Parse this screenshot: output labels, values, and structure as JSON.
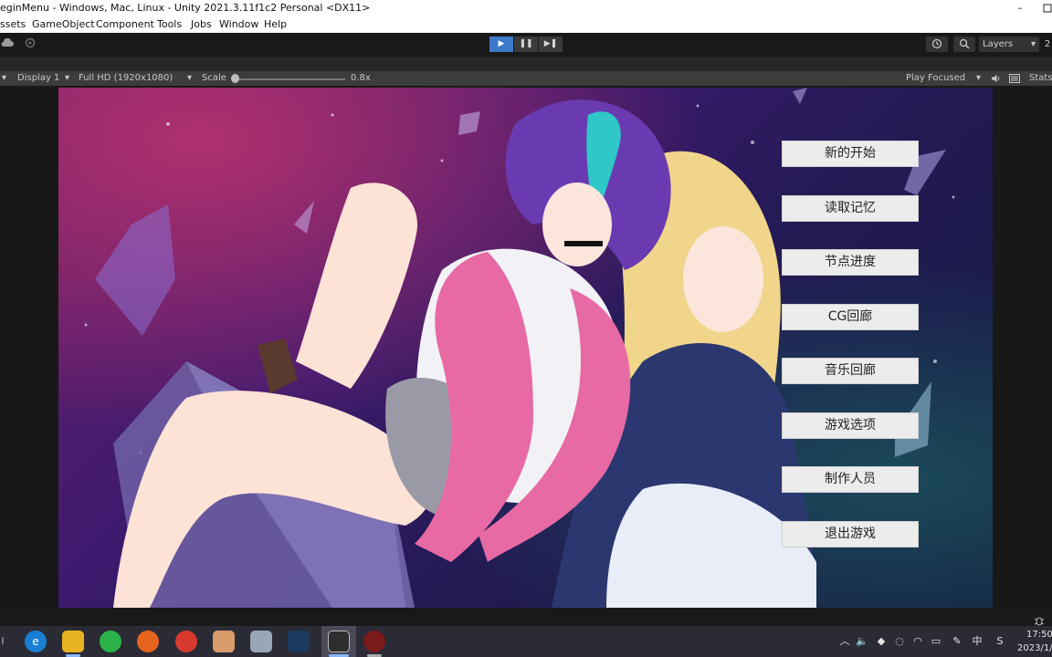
{
  "window": {
    "title": "eginMenu - Windows, Mac, Linux - Unity 2021.3.11f1c2 Personal <DX11>",
    "minimize": "–"
  },
  "menu": [
    "ssets",
    "GameObject",
    "Component",
    "Tools",
    "Jobs",
    "Window",
    "Help"
  ],
  "toolbar": {
    "play": "▶",
    "pause": "❚❚",
    "step": "▶❚",
    "layers_label": "Layers",
    "edge_label": "2"
  },
  "game_view": {
    "display": "Display 1",
    "resolution": "Full HD (1920x1080)",
    "scale_label": "Scale",
    "scale_value": "0.8x",
    "scale_fraction": 0.0,
    "play_mode": "Play Focused",
    "stats_label": "Stats"
  },
  "game_menu": {
    "buttons": [
      "新的开始",
      "读取记忆",
      "节点进度",
      "CG回廊",
      "音乐回廊",
      "游戏选项",
      "制作人员",
      "退出游戏"
    ]
  },
  "taskbar": {
    "tray_lang": "中",
    "clock_time": "17:50",
    "clock_date": "2023/1/"
  },
  "colors": {
    "play_active": "#3d79c9",
    "editor_dark": "#191919",
    "button_bg": "#ececec"
  }
}
